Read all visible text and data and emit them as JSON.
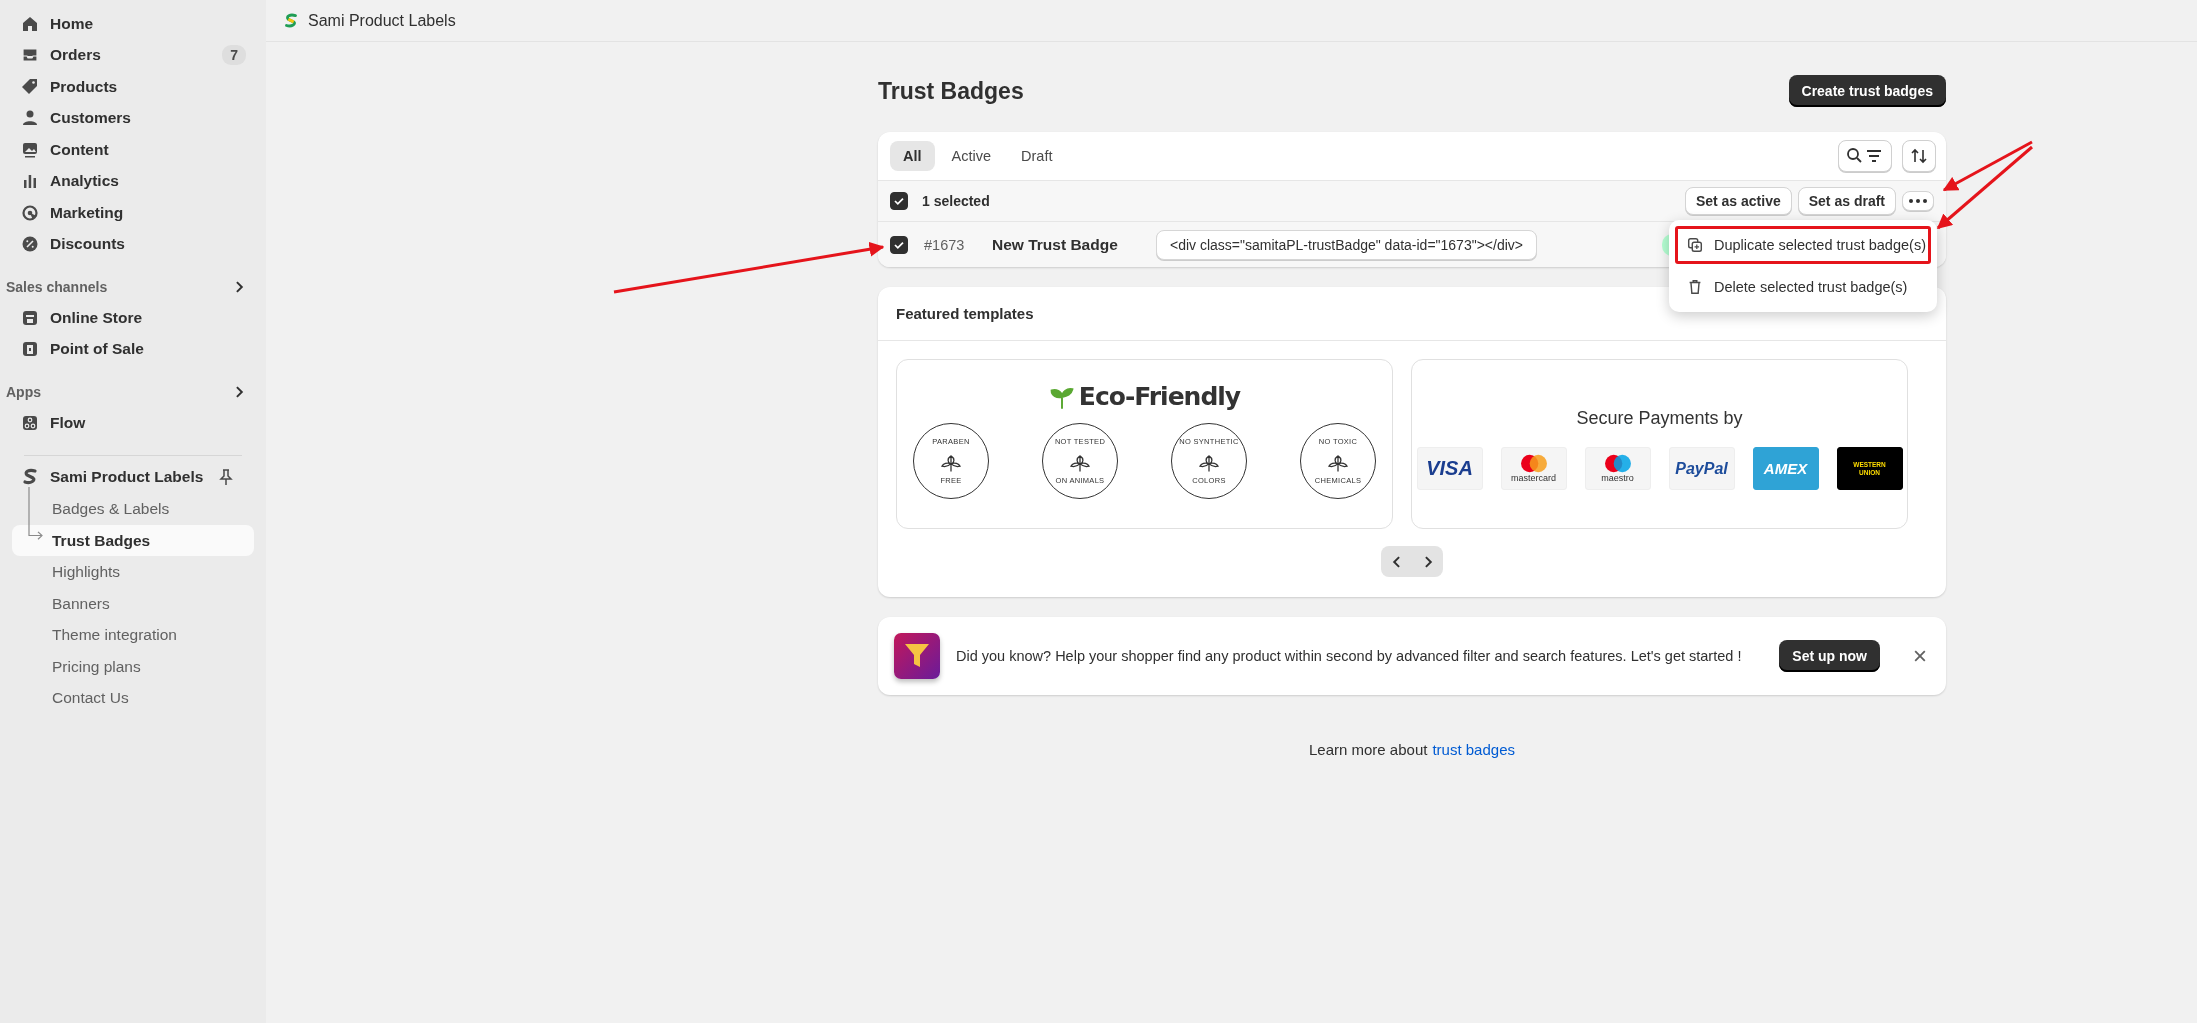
{
  "app_bar": {
    "title": "Sami Product Labels"
  },
  "sidebar": {
    "items": [
      {
        "label": "Home"
      },
      {
        "label": "Orders",
        "badge": "7"
      },
      {
        "label": "Products"
      },
      {
        "label": "Customers"
      },
      {
        "label": "Content"
      },
      {
        "label": "Analytics"
      },
      {
        "label": "Marketing"
      },
      {
        "label": "Discounts"
      }
    ],
    "sections": [
      {
        "title": "Sales channels",
        "items": [
          {
            "label": "Online Store"
          },
          {
            "label": "Point of Sale"
          }
        ]
      },
      {
        "title": "Apps",
        "items": [
          {
            "label": "Flow"
          }
        ]
      }
    ],
    "app": {
      "name": "Sami Product Labels",
      "items": [
        {
          "label": "Badges & Labels",
          "selected": false
        },
        {
          "label": "Trust Badges",
          "selected": true
        },
        {
          "label": "Highlights",
          "selected": false
        },
        {
          "label": "Banners",
          "selected": false
        },
        {
          "label": "Theme integration",
          "selected": false
        },
        {
          "label": "Pricing plans",
          "selected": false
        },
        {
          "label": "Contact Us",
          "selected": false
        }
      ]
    }
  },
  "page": {
    "title": "Trust Badges",
    "primary_button": "Create trust badges"
  },
  "list": {
    "tabs": [
      {
        "label": "All",
        "selected": true
      },
      {
        "label": "Active",
        "selected": false
      },
      {
        "label": "Draft",
        "selected": false
      }
    ],
    "bulk": {
      "checked": true,
      "label": "1 selected",
      "actions": [
        "Set as active",
        "Set as draft"
      ]
    },
    "rows": [
      {
        "checked": true,
        "id": "#1673",
        "name": "New Trust Badge",
        "code": "<div class=\"samitaPL-trustBadge\" data-id=\"1673\"></div>"
      }
    ]
  },
  "menu": {
    "items": [
      {
        "label": "Duplicate selected trust badge(s)",
        "highlighted": true
      },
      {
        "label": "Delete selected trust badge(s)",
        "highlighted": false
      }
    ]
  },
  "templates": {
    "title": "Featured templates",
    "cards": [
      {
        "kind": "seals",
        "heading": "Eco-Friendly",
        "seals": [
          {
            "top": "PARABEN",
            "bottom": "FREE"
          },
          {
            "top": "NOT TESTED",
            "bottom": "ON ANIMALS"
          },
          {
            "top": "NO SYNTHETIC",
            "bottom": "COLORS"
          },
          {
            "top": "NO TOXIC",
            "bottom": "CHEMICALS"
          }
        ]
      },
      {
        "kind": "logos",
        "heading": "Secure Payments by",
        "logos": [
          "VISA",
          "mastercard",
          "maestro",
          "PayPal",
          "AMEX",
          "WESTERN UNION"
        ]
      }
    ]
  },
  "banner": {
    "text": "Did you know? Help your shopper find any product within second by advanced filter and search features. Let's get started !",
    "button": "Set up now"
  },
  "footer": {
    "text": "Learn more about",
    "link": "trust badges"
  }
}
